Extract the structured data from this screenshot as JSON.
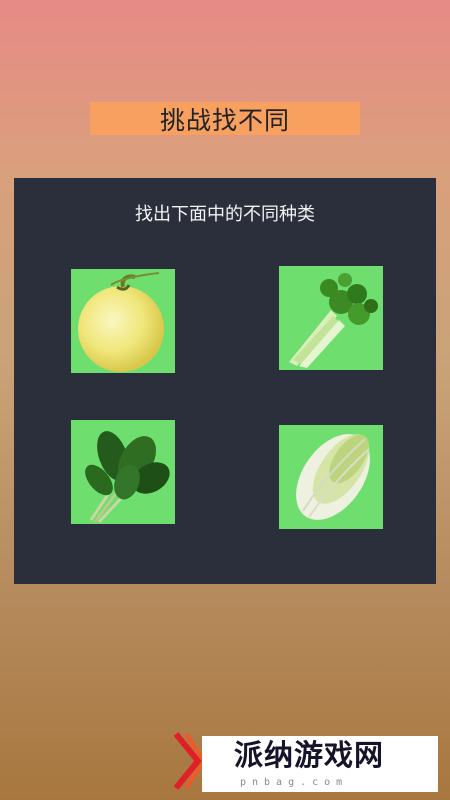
{
  "header": {
    "title": "挑战找不同"
  },
  "panel": {
    "instruction": "找出下面中的不同种类",
    "cards": [
      {
        "label": "melon",
        "icon": "melon-icon"
      },
      {
        "label": "celery",
        "icon": "celery-icon"
      },
      {
        "label": "spinach",
        "icon": "spinach-icon"
      },
      {
        "label": "chinese-cabbage",
        "icon": "cabbage-icon"
      }
    ]
  },
  "watermark": {
    "brand": "派纳游戏网",
    "url": "pnbag.com"
  },
  "colors": {
    "card_bg": "#6ede6e",
    "panel_bg": "#2a2f3b",
    "banner_bg": "#f8a060"
  }
}
